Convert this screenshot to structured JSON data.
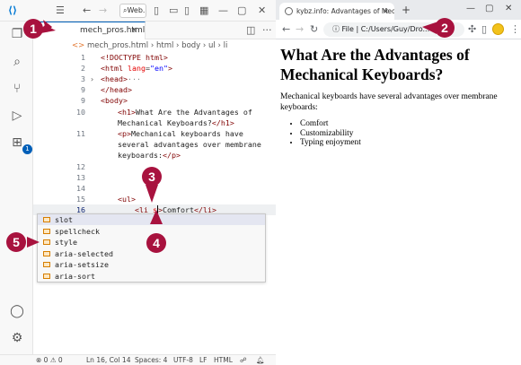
{
  "vscode": {
    "search_label": "Web...",
    "tab": {
      "filename": "mech_pros.html",
      "close": "×"
    },
    "breadcrumb": {
      "file": "mech_pros.html",
      "parts": [
        "html",
        "body",
        "ul",
        "li"
      ]
    },
    "code_lines": [
      {
        "num": "1",
        "text": "<!DOCTYPE html>"
      },
      {
        "num": "2",
        "text": "<html lang=\"en\">"
      },
      {
        "num": "3",
        "text": "<head>···"
      },
      {
        "num": "9",
        "text": "</head>"
      },
      {
        "num": "9",
        "text": "<body>"
      },
      {
        "num": "10",
        "text": "<h1>What Are the Advantages of"
      },
      {
        "num": "",
        "text": "Mechanical Keyboards?</h1>"
      },
      {
        "num": "11",
        "text": "<p>Mechanical keyboards have"
      },
      {
        "num": "",
        "text": "several advantages over membrane"
      },
      {
        "num": "",
        "text": "keyboards:</p>"
      },
      {
        "num": "12",
        "text": ""
      },
      {
        "num": "13",
        "text": ""
      },
      {
        "num": "14",
        "text": ""
      },
      {
        "num": "15",
        "text": "<ul>"
      },
      {
        "num": "16",
        "text": "<li s>Comfort</li>"
      }
    ],
    "suggestions": [
      "slot",
      "spellcheck",
      "style",
      "aria-selected",
      "aria-setsize",
      "aria-sort"
    ],
    "status": {
      "errors": "⊗ 0 ⚠ 0",
      "position": "Ln 16, Col 14",
      "spaces": "Spaces: 4",
      "encoding": "UTF-8",
      "eol": "LF",
      "language": "HTML"
    }
  },
  "browser": {
    "tab_title": "kybz.info: Advantages of Mecha...",
    "tab_close": "×",
    "new_tab": "+",
    "address": "File | C:/Users/Guy/Dro...",
    "heading": "What Are the Advantages of Mechanical Keyboards?",
    "paragraph": "Mechanical keyboards have several advantages over membrane keyboards:",
    "list": [
      "Comfort",
      "Customizability",
      "Typing enjoyment"
    ]
  },
  "callouts": [
    "1",
    "2",
    "3",
    "4",
    "5"
  ],
  "colors": {
    "callout": "#a8123e",
    "vscode_accent": "#005fb8"
  }
}
